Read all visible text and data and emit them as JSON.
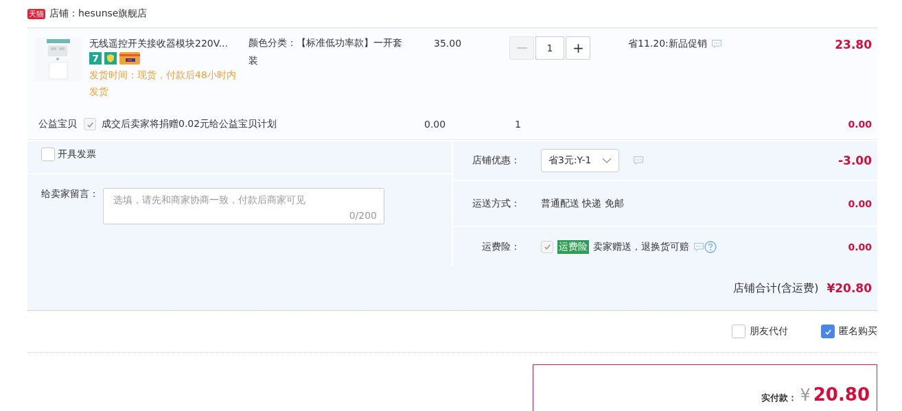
{
  "shop": {
    "badge": "天猫",
    "name": "店铺：hesunse旗舰店"
  },
  "item": {
    "title": "无线遥控开关接收器模块220V...",
    "tags": [
      {
        "kind": "days",
        "text": "7"
      },
      {
        "kind": "shield"
      },
      {
        "kind": "card"
      }
    ],
    "ship_time": "发货时间：现货，付款后48小时内发货",
    "sku_label": "颜色分类：",
    "sku_value": "【标准低功率款】一开套装",
    "price": "35.00",
    "quantity": "1",
    "minus_disabled": true,
    "promo": "省11.20:新品促销",
    "total": "23.80"
  },
  "charity": {
    "label": "公益宝贝",
    "checked": true,
    "disabled": true,
    "text": "成交后卖家将捐赠0.02元给公益宝贝计划",
    "price": "0.00",
    "quantity": "1",
    "total": "0.00"
  },
  "invoice": {
    "label": "开具发票",
    "checked": false
  },
  "message": {
    "label": "给卖家留言：",
    "placeholder": "选填，请先和商家协商一致，付款后商家可见",
    "counter": "0/200"
  },
  "discount": {
    "label": "店铺优惠：",
    "value": "省3元:Y-1",
    "amount": "-3.00"
  },
  "shipping": {
    "label": "运送方式：",
    "value": "普通配送 快递 免邮",
    "amount": "0.00"
  },
  "insurance": {
    "label": "运费险：",
    "checked": true,
    "disabled": true,
    "badge": "运费险",
    "text": "卖家赠送，退换货可赔",
    "amount": "0.00"
  },
  "shop_total": {
    "label": "店铺合计(含运费)",
    "value": "¥20.80"
  },
  "options": [
    {
      "label": "朋友代付",
      "checked": false
    },
    {
      "label": "匿名购买",
      "checked": true
    }
  ],
  "payment": {
    "label": "实付款：",
    "currency": "¥",
    "amount": "20.80"
  }
}
